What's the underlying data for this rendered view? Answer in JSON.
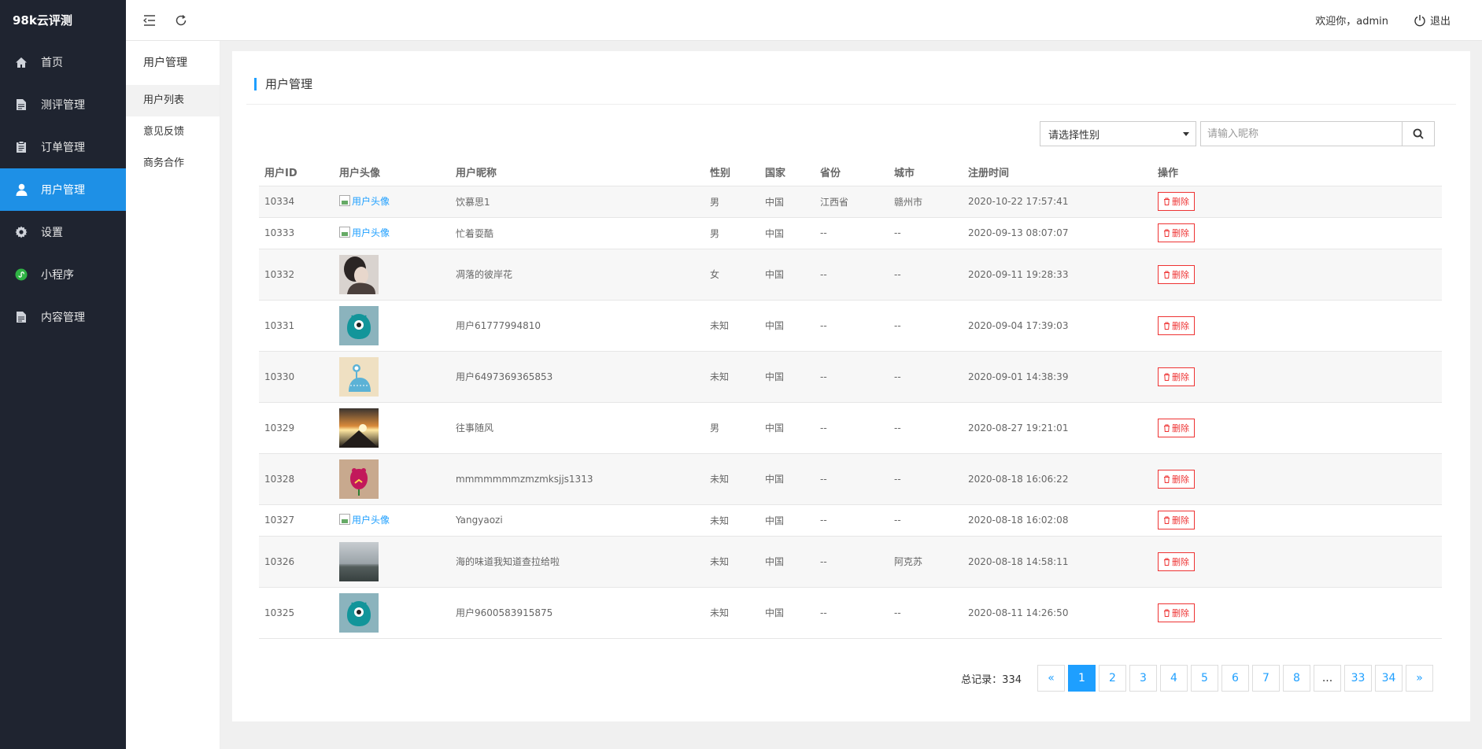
{
  "app": {
    "brand": "98k云评测"
  },
  "sidebar": {
    "items": [
      {
        "label": "首页",
        "icon": "home-icon",
        "active": false
      },
      {
        "label": "测评管理",
        "icon": "document-icon",
        "active": false
      },
      {
        "label": "订单管理",
        "icon": "clipboard-icon",
        "active": false
      },
      {
        "label": "用户管理",
        "icon": "user-icon",
        "active": true
      },
      {
        "label": "设置",
        "icon": "gear-icon",
        "active": false
      },
      {
        "label": "小程序",
        "icon": "miniprogram-icon",
        "active": false
      },
      {
        "label": "内容管理",
        "icon": "document-icon",
        "active": false
      }
    ]
  },
  "subnav": {
    "title": "用户管理",
    "items": [
      {
        "label": "用户列表",
        "active": true
      },
      {
        "label": "意见反馈",
        "active": false
      },
      {
        "label": "商务合作",
        "active": false
      }
    ]
  },
  "header": {
    "welcome": "欢迎你，admin",
    "logout": "退出"
  },
  "main": {
    "title": "用户管理",
    "filter": {
      "gender_select": "请选择性别",
      "search_placeholder": "请输入昵称"
    },
    "table": {
      "columns": [
        "用户ID",
        "用户头像",
        "用户昵称",
        "性别",
        "国家",
        "省份",
        "城市",
        "注册时间",
        "操作"
      ],
      "avatar_alt": "用户头像",
      "delete_label": "删除",
      "rows": [
        {
          "id": "10334",
          "avatar": "broken",
          "nickname": "饮慕思1",
          "gender": "男",
          "country": "中国",
          "province": "江西省",
          "city": "赣州市",
          "registered": "2020-10-22 17:57:41"
        },
        {
          "id": "10333",
          "avatar": "broken",
          "nickname": "忙着耍酷",
          "gender": "男",
          "country": "中国",
          "province": "--",
          "city": "--",
          "registered": "2020-09-13 08:07:07"
        },
        {
          "id": "10332",
          "avatar": "portrait",
          "nickname": "凋落的彼岸花",
          "gender": "女",
          "country": "中国",
          "province": "--",
          "city": "--",
          "registered": "2020-09-11 19:28:33"
        },
        {
          "id": "10331",
          "avatar": "teal-monster",
          "nickname": "用户61777994810",
          "gender": "未知",
          "country": "中国",
          "province": "--",
          "city": "--",
          "registered": "2020-09-04 17:39:03"
        },
        {
          "id": "10330",
          "avatar": "beige-monster",
          "nickname": "用户6497369365853",
          "gender": "未知",
          "country": "中国",
          "province": "--",
          "city": "--",
          "registered": "2020-09-01 14:38:39"
        },
        {
          "id": "10329",
          "avatar": "sunset",
          "nickname": "往事随风",
          "gender": "男",
          "country": "中国",
          "province": "--",
          "city": "--",
          "registered": "2020-08-27 19:21:01"
        },
        {
          "id": "10328",
          "avatar": "pink-monster",
          "nickname": "mmmmmmmzmzmksjjs1313",
          "gender": "未知",
          "country": "中国",
          "province": "--",
          "city": "--",
          "registered": "2020-08-18 16:06:22"
        },
        {
          "id": "10327",
          "avatar": "broken",
          "nickname": "Yangyaozi",
          "gender": "未知",
          "country": "中国",
          "province": "--",
          "city": "--",
          "registered": "2020-08-18 16:02:08"
        },
        {
          "id": "10326",
          "avatar": "seascape",
          "nickname": "海的味道我知道查拉给啦",
          "gender": "未知",
          "country": "中国",
          "province": "--",
          "city": "阿克苏",
          "registered": "2020-08-18 14:58:11"
        },
        {
          "id": "10325",
          "avatar": "teal-monster",
          "nickname": "用户9600583915875",
          "gender": "未知",
          "country": "中国",
          "province": "--",
          "city": "--",
          "registered": "2020-08-11 14:26:50"
        }
      ]
    },
    "pagination": {
      "total_label": "总记录：334",
      "prev": "«",
      "next": "»",
      "pages": [
        "1",
        "2",
        "3",
        "4",
        "5",
        "6",
        "7",
        "8",
        "...",
        "33",
        "34"
      ],
      "current": "1"
    }
  },
  "colors": {
    "sidebar_bg": "#1f2430",
    "accent": "#1e90e6",
    "link": "#1e9fff",
    "danger": "#e33333"
  }
}
